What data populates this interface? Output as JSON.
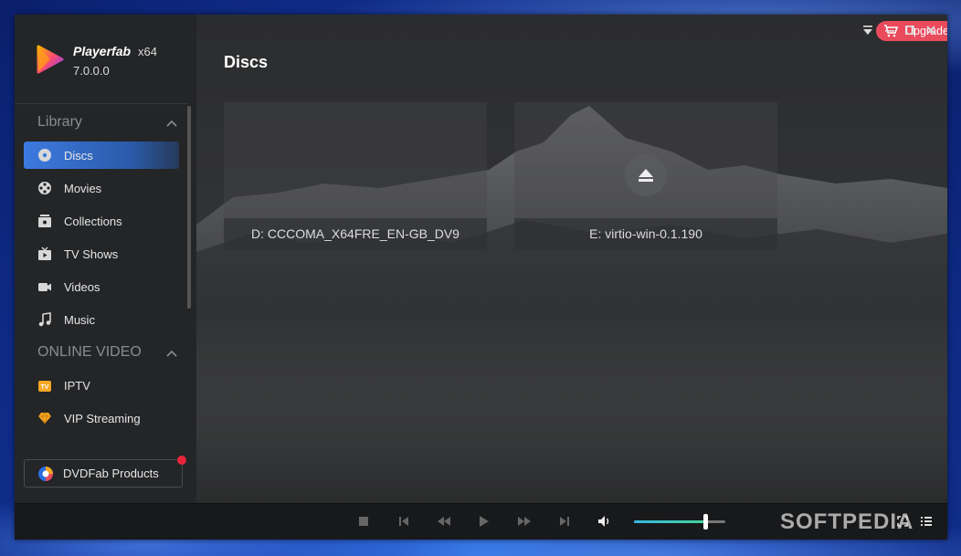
{
  "app": {
    "name": "Playerfab",
    "arch": "x64",
    "version": "7.0.0.0",
    "upgrade_label": "Upgrade to Paid Version"
  },
  "sidebar": {
    "library_header": "Library",
    "library_items": [
      {
        "label": "Discs",
        "icon": "disc-icon",
        "active": true
      },
      {
        "label": "Movies",
        "icon": "film-reel-icon"
      },
      {
        "label": "Collections",
        "icon": "collection-icon"
      },
      {
        "label": "TV Shows",
        "icon": "tv-icon"
      },
      {
        "label": "Videos",
        "icon": "video-camera-icon"
      },
      {
        "label": "Music",
        "icon": "music-note-icon"
      }
    ],
    "online_header": "ONLINE VIDEO",
    "online_items": [
      {
        "label": "IPTV",
        "icon": "iptv-icon"
      },
      {
        "label": "VIP Streaming",
        "icon": "diamond-icon"
      }
    ],
    "products_label": "DVDFab Products"
  },
  "main": {
    "title": "Discs",
    "discs": [
      {
        "label": "D: CCCOMA_X64FRE_EN-GB_DV9"
      },
      {
        "label": "E: virtio-win-0.1.190"
      }
    ]
  },
  "player": {
    "volume_percent": 78
  },
  "watermark": "SOFTPEDIA",
  "colors": {
    "accent": "#3d7ae0",
    "upgrade": "#e94a5c",
    "sidebar_bg": "#242527",
    "main_bg": "#2a2b2d"
  }
}
